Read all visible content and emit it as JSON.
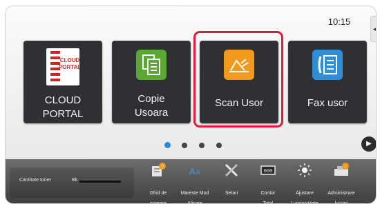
{
  "status": {
    "time": "10:15",
    "side_tab_glyph": "◂ll"
  },
  "tiles": [
    {
      "label": "CLOUD PORTAL",
      "icon": "cloud-portal-icon",
      "icon_text": "CLOUD\nPORTAL"
    },
    {
      "label": "Copie Usoara",
      "label_lines": [
        "Copie",
        "Usoara"
      ],
      "icon": "copy-icon"
    },
    {
      "label": "Scan Usor",
      "icon": "scan-icon",
      "selected": true
    },
    {
      "label": "Fax usor",
      "icon": "fax-icon"
    }
  ],
  "pagination": {
    "pages": 4,
    "current": 1,
    "next_glyph": "▶"
  },
  "toner": {
    "label": "Cantitate toner",
    "color": "Bk",
    "level": 1.0
  },
  "functions": [
    {
      "label": "Ghid de operare",
      "lines": [
        "Ghid de",
        "operare"
      ],
      "icon": "guide-icon"
    },
    {
      "label": "Mareste Mod Afisare",
      "lines": [
        "Mareste Mod",
        "Afisare"
      ],
      "icon": "enlarge-display-icon"
    },
    {
      "label": "Setari",
      "lines": [
        "Setari"
      ],
      "icon": "settings-icon"
    },
    {
      "label": "Contor Total",
      "lines": [
        "Contor",
        "Total"
      ],
      "icon": "counter-icon",
      "counter_text": "000"
    },
    {
      "label": "Ajustare Luminozitate",
      "lines": [
        "Ajustare",
        "Luminozitate"
      ],
      "icon": "brightness-icon"
    },
    {
      "label": "Administrare lucrari",
      "lines": [
        "Administrare",
        "lucrari"
      ],
      "icon": "job-status-icon"
    }
  ],
  "colors": {
    "highlight": "#e3193c",
    "copy": "#5aa832",
    "scan": "#f29a1d",
    "fax": "#2e8fd6",
    "dot_active": "#2a8ad8",
    "tile_bg": "#2f3033"
  }
}
